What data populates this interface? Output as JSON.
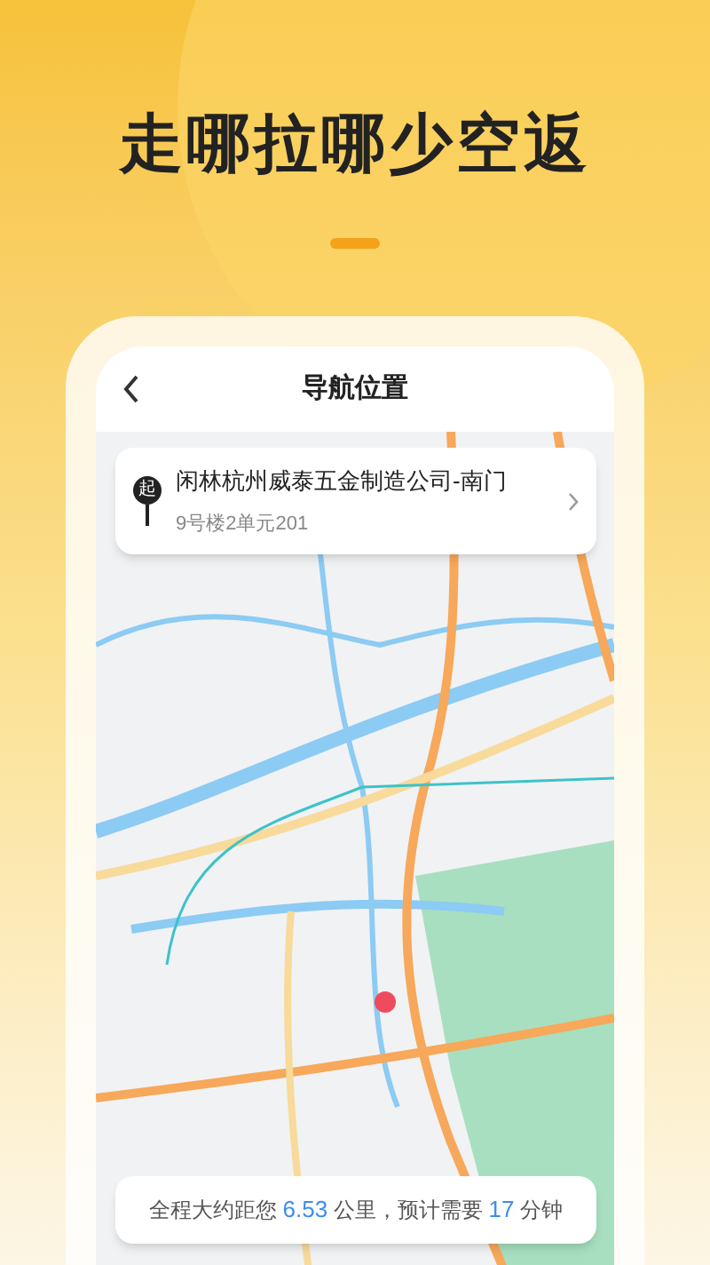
{
  "headline": "走哪拉哪少空返",
  "screen": {
    "title": "导航位置"
  },
  "location": {
    "badge": "起",
    "name": "闲林杭州威泰五金制造公司-南门",
    "detail": "9号楼2单元201"
  },
  "summary": [
    {
      "text": "全程大约距您 ",
      "highlight": false
    },
    {
      "text": "6.53",
      "highlight": true
    },
    {
      "text": " 公里，预计需要 ",
      "highlight": false
    },
    {
      "text": "17",
      "highlight": true
    },
    {
      "text": " 分钟",
      "highlight": false
    }
  ]
}
